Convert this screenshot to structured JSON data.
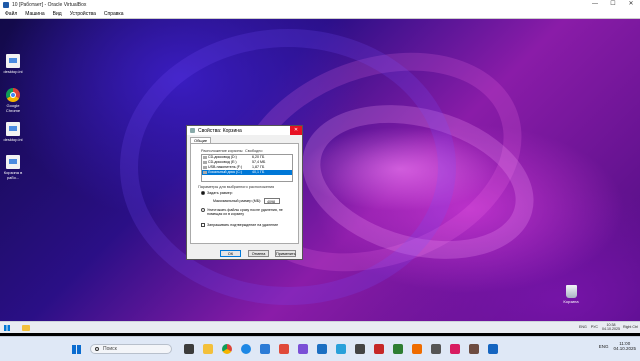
{
  "vbox": {
    "title": "10 [Работает] - Oracle VirtualBox",
    "menu": [
      "Файл",
      "Машина",
      "Вид",
      "Устройства",
      "Справка"
    ],
    "controls": {
      "minimize": "—",
      "maximize": "☐",
      "close": "✕"
    }
  },
  "desktop": {
    "icons": [
      {
        "label": "desktop.ini",
        "icon": "file-icon"
      },
      {
        "label": "Google Chrome",
        "icon": "chrome-icon"
      },
      {
        "label": "desktop.ini",
        "icon": "file-icon"
      },
      {
        "label": "Корзина в рабо...",
        "icon": "file-icon"
      }
    ],
    "recycle_bin_label": "Корзина"
  },
  "dialog": {
    "title": "Свойства: Корзина",
    "tab": "Общие",
    "col_location": "Расположение корзины",
    "col_free": "Свободно",
    "rows": [
      {
        "name": "CD-дисковод (D:)",
        "free": "6,20 ГБ",
        "selected": false
      },
      {
        "name": "CD-дисковод (E:)",
        "free": "57,4 МБ",
        "selected": false
      },
      {
        "name": "USB-накопитель (F:)",
        "free": "1,87 ГБ",
        "selected": false
      },
      {
        "name": "Локальный диск (C:)",
        "free": "40,1 ГБ",
        "selected": true
      }
    ],
    "group_label": "Параметры для выбранного расположения",
    "opt_size": "Задать размер:",
    "max_size_label": "Максимальный размер (МБ):",
    "max_size_value": "4098",
    "opt_delete": "Уничтожать файлы сразу после удаления, не помещая их в корзину",
    "confirm_label": "Запрашивать подтверждение на удаление",
    "ok": "ОК",
    "cancel": "Отмена",
    "apply": "Применить"
  },
  "guest_taskbar": {
    "lang": "ENG",
    "lang2": "РУС",
    "time": "10:38",
    "date": "04.10.2025"
  },
  "vbox_status": {
    "host_key": "Right Ctrl"
  },
  "host_taskbar": {
    "search_placeholder": "Поиск",
    "lang": "ENG",
    "time": "11:00",
    "date": "04.10.2025"
  },
  "colors": {
    "selection": "#0078d7",
    "close_red": "#e81123"
  }
}
